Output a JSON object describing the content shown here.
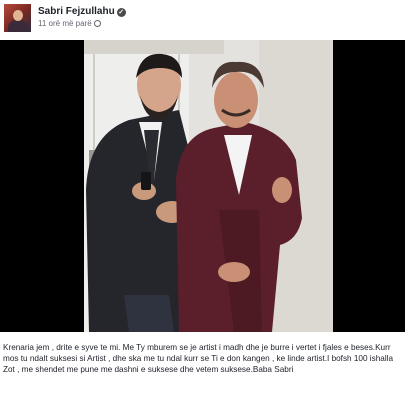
{
  "post": {
    "author": "Sabri Fejzullahu",
    "timestamp": "11 orë më parë",
    "caption": "Krenaria jem , drite e syve te mi. Me Ty mburem se je artist i madh dhe je burre i vertet i fjales e beses.Kurr mos tu ndalt suksesi si Artist , dhe ska me tu ndal kurr se Ti e don kangen , ke linde artist.I bofsh 100 ishalla Zot , me shendet me pune me dashni e suksese dhe vetem suksese.Baba Sabri"
  },
  "icons": {
    "verified": "verified-badge-icon",
    "audience": "globe-icon"
  },
  "colors": {
    "photo_letterbox": "#000000",
    "suit_left": "#25262b",
    "suit_right": "#5a1f2a"
  }
}
